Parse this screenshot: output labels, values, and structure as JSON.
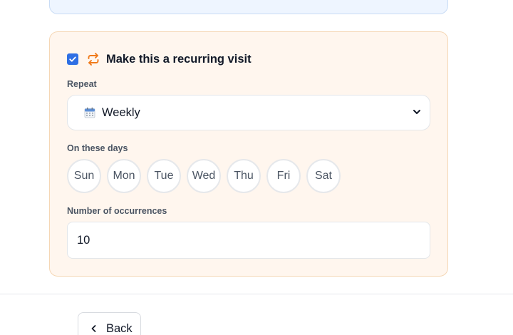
{
  "recurring": {
    "enabled": true,
    "title": "Make this a recurring visit",
    "repeat_label": "Repeat",
    "repeat_value": "Weekly",
    "days_label": "On these days",
    "days": [
      "Sun",
      "Mon",
      "Tue",
      "Wed",
      "Thu",
      "Fri",
      "Sat"
    ],
    "occurrences_label": "Number of occurrences",
    "occurrences_value": "10"
  },
  "footer": {
    "back_label": "Back"
  },
  "colors": {
    "accent": "#2f6fe4",
    "repeat_icon": "#f07a1a",
    "card_background": "#fff6ee",
    "card_border": "#f5d7b5"
  },
  "icons": {
    "checkbox": "check-icon",
    "repeat": "repeat-icon",
    "repeat_select": "calendar-icon",
    "dropdown": "chevron-down-icon",
    "back": "chevron-left-icon"
  }
}
